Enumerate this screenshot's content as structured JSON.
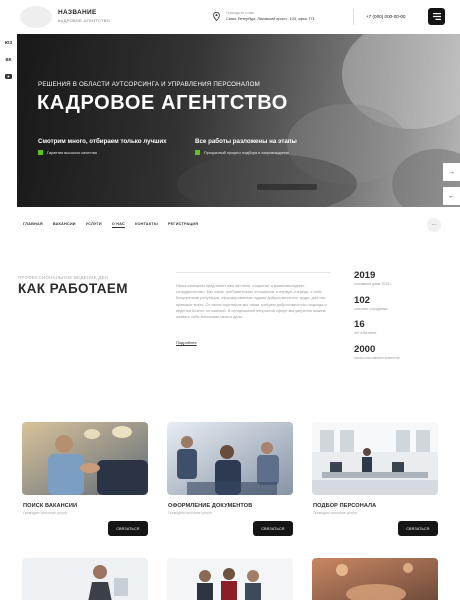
{
  "header": {
    "brand_name": "НАЗВАНИЕ",
    "brand_sub": "КАДРОВОЕ АГЕНТСТВО",
    "address_label": "Приходите к нам",
    "address": "Санкт-Петербург, Лиговский просп., 103, офис 771",
    "phone": "+7 (000) 000-00-00",
    "icons": {
      "location": "map-pin-icon",
      "menu": "hamburger-menu-icon"
    }
  },
  "social": [
    "ЮЗ",
    "ВК",
    "YT"
  ],
  "hero": {
    "subtitle": "РЕШЕНИЯ В ОБЛАСТИ АУТСОРСИНГА И УПРАВЛЕНИЯ ПЕРСОНАЛОМ",
    "title": "КАДРОВОЕ АГЕНТСТВО",
    "features": [
      {
        "title": "Смотрим много, отбираем только лучших",
        "text": "Гарантия высокого качества"
      },
      {
        "title": "Все работы разложены на этапы",
        "text": "Прозрачный процесс подбора и сопровождения"
      }
    ],
    "accent_color": "#5fc31e",
    "arrows": [
      "→",
      "←"
    ]
  },
  "nav": {
    "items": [
      "ГЛАВНАЯ",
      "ВАКАНСИИ",
      "УСЛУГИ",
      "О НАС",
      "КОНТАКТЫ",
      "РЕГИСТРАЦИЯ"
    ],
    "active_index": 3,
    "more": "..."
  },
  "about": {
    "kicker": "ПРОФЕССИОНАЛЬНОЕ ВЕДЕНИЕ ДЕЛ",
    "title": "КАК РАБОТАЕМ",
    "text": "Наша компания предлагает вам честные, открытые и взаимовыгодные сотрудничество. Мы очень требовательны отношения, в первую очередь, к себе. Безупречная репутация, сформированная годами добросовестного труда, для нас превыше всего. От своих партнеров мы также требуем добросовестного подхода и ведения бизнес отношений. В сегодняшней непростой сфере мы уверенно можем назвать себя знатоками своего дела.",
    "link": "Подробнее",
    "stats": [
      {
        "value": "2019",
        "label": "основание дома 2019 г."
      },
      {
        "value": "102",
        "label": "опытных сотрудника"
      },
      {
        "value": "16",
        "label": "лет в бизнесе"
      },
      {
        "value": "2000",
        "label": "тысяч постоянных клиентов"
      }
    ]
  },
  "services": [
    {
      "title": "ПОИСК ВАКАНСИИ",
      "subtitle": "Приводим описание услуги",
      "button": "СВЯЗАТЬСЯ"
    },
    {
      "title": "ОФОРМЛЕНИЕ ДОКУМЕНТОВ",
      "subtitle": "Приводим описание услуги",
      "button": "СВЯЗАТЬСЯ"
    },
    {
      "title": "ПОДБОР ПЕРСОНАЛА",
      "subtitle": "Приводим описание услуги",
      "button": "СВЯЗАТЬСЯ"
    }
  ]
}
